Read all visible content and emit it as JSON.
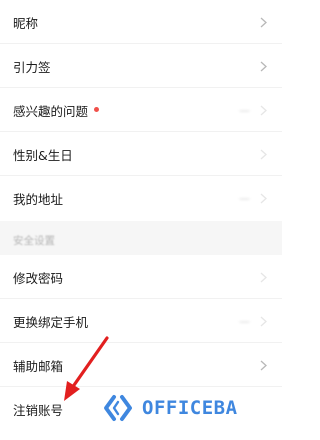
{
  "settings": {
    "items": [
      {
        "label": "昵称",
        "value": "",
        "chevron": "chevron-right-icon"
      },
      {
        "label": "引力签",
        "value": "",
        "chevron": "chevron-right-icon"
      },
      {
        "label": "感兴趣的问题",
        "value": "—",
        "badge_color": "#f0504a",
        "chevron": "chevron-right-icon"
      },
      {
        "label": "性别&生日",
        "value": "",
        "chevron": "chevron-right-icon"
      },
      {
        "label": "我的地址",
        "value": "—",
        "chevron": "chevron-right-icon"
      }
    ],
    "section_title": "安全设置",
    "security_items": [
      {
        "label": "修改密码",
        "value": "",
        "chevron": "chevron-right-icon"
      },
      {
        "label": "更换绑定手机",
        "value": "—",
        "chevron": "chevron-right-icon"
      },
      {
        "label": "辅助邮箱",
        "value": "",
        "chevron": "chevron-right-icon"
      },
      {
        "label": "注销账号",
        "value": "",
        "chevron": ""
      }
    ]
  },
  "annotation": {
    "arrow_color": "#e21f1f",
    "arrow_icon": "red-arrow-icon"
  },
  "watermark": {
    "text": "OFFICEBA",
    "color": "#3f87df",
    "logo_icon": "officeba-logo-icon"
  }
}
